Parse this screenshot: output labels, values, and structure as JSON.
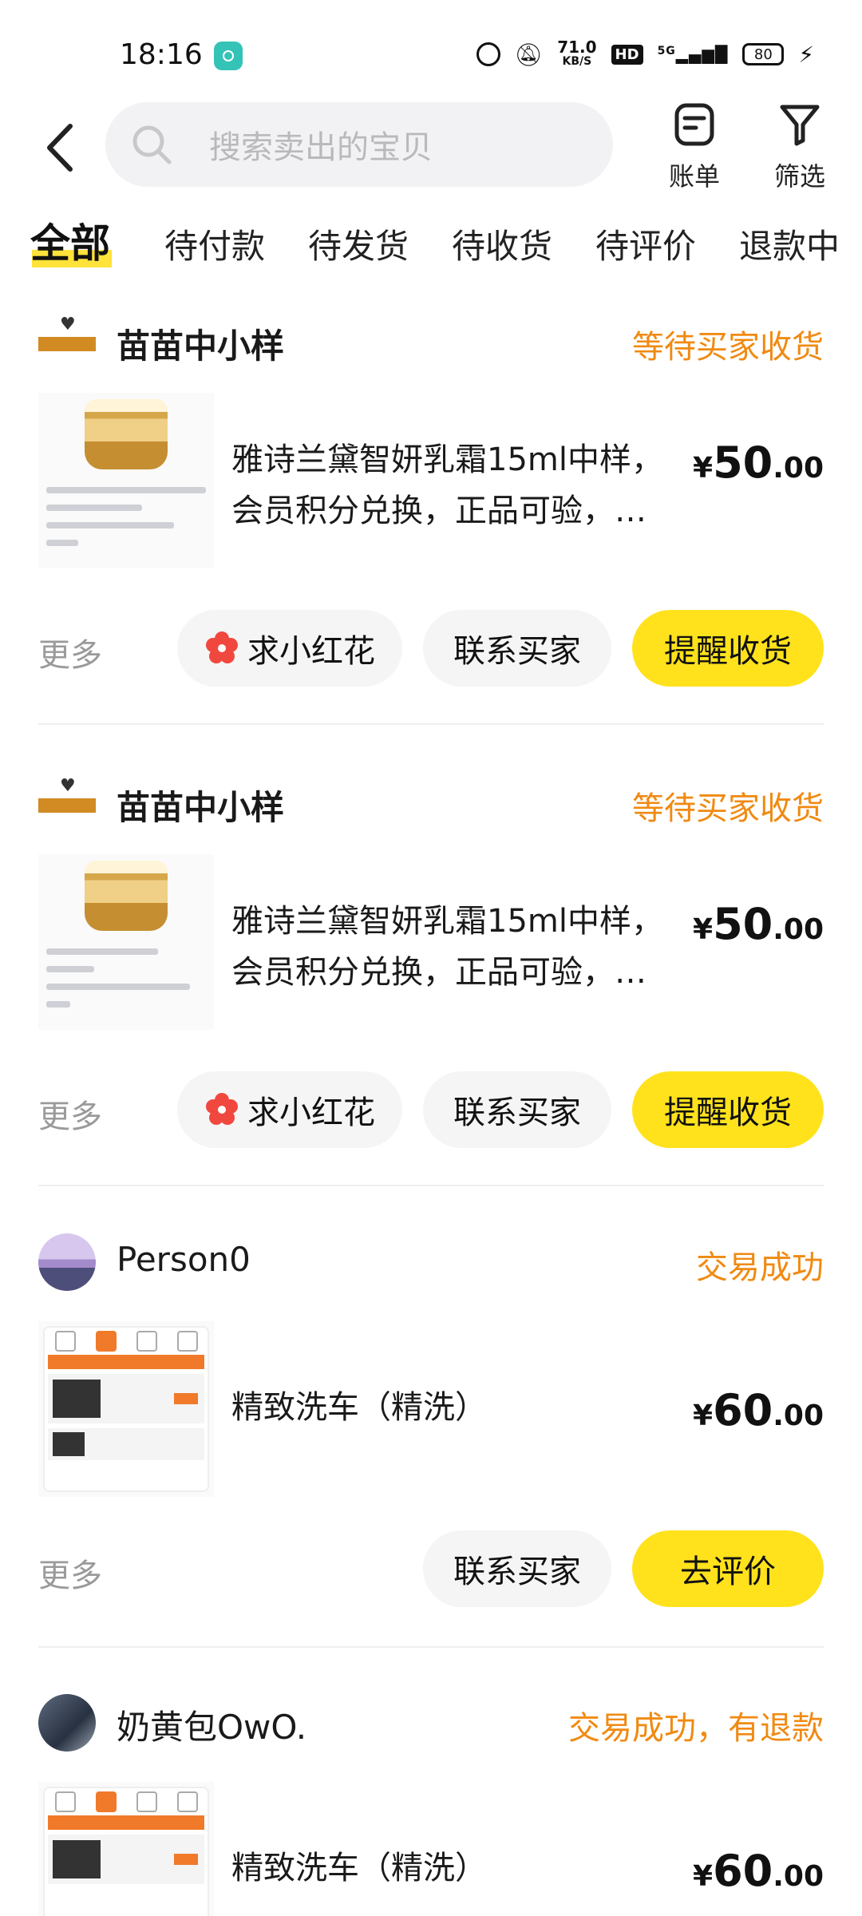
{
  "status_bar": {
    "time": "18:16",
    "net_speed_value": "71.0",
    "net_speed_unit": "KB/S",
    "hd": "HD",
    "signal": "5G",
    "battery": "80"
  },
  "header": {
    "search_placeholder": "搜索卖出的宝贝",
    "bill_label": "账单",
    "filter_label": "筛选"
  },
  "tabs": [
    "全部",
    "待付款",
    "待发货",
    "待收货",
    "待评价",
    "退款中"
  ],
  "orders": [
    {
      "shop": "苗苗中小样",
      "status": "等待买家收货",
      "title_line1": "雅诗兰黛智妍乳霜15ml中样，",
      "title_line2": "会员积分兑换，正品可验，…",
      "price_symbol": "¥",
      "price_int": "50",
      "price_dec": ".00",
      "more": "更多",
      "btn_flower": "求小红花",
      "btn_contact": "联系买家",
      "btn_primary": "提醒收货"
    },
    {
      "shop": "苗苗中小样",
      "status": "等待买家收货",
      "title_line1": "雅诗兰黛智妍乳霜15ml中样，",
      "title_line2": "会员积分兑换，正品可验，…",
      "price_symbol": "¥",
      "price_int": "50",
      "price_dec": ".00",
      "more": "更多",
      "btn_flower": "求小红花",
      "btn_contact": "联系买家",
      "btn_primary": "提醒收货"
    },
    {
      "shop": "Person0",
      "status": "交易成功",
      "title_line1": "精致洗车（精洗）",
      "price_symbol": "¥",
      "price_int": "60",
      "price_dec": ".00",
      "more": "更多",
      "btn_contact": "联系买家",
      "btn_primary": "去评价"
    },
    {
      "shop": "奶黄包OwO.",
      "status": "交易成功，有退款",
      "title_line1": "精致洗车（精洗）",
      "price_symbol": "¥",
      "price_int": "60",
      "price_dec": ".00"
    }
  ],
  "colors": {
    "accent_yellow": "#ffe21c",
    "status_orange": "#f08a12",
    "flower_red": "#f0483e"
  }
}
